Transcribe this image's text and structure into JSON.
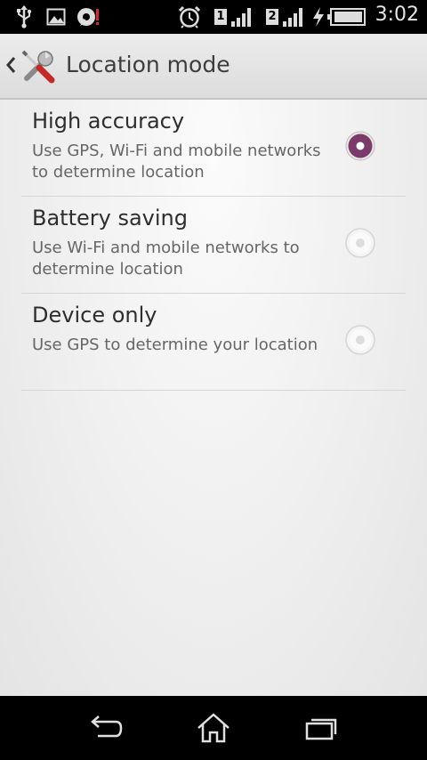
{
  "status_bar": {
    "time": "3:02",
    "sim1_label": "1",
    "sim2_label": "2",
    "icons": [
      "usb-icon",
      "image-icon",
      "notification-icon",
      "alarm-icon",
      "signal-icon",
      "charging-icon",
      "battery-icon"
    ]
  },
  "action_bar": {
    "title": "Location mode",
    "icon": "settings-tools-icon"
  },
  "options": [
    {
      "title": "High accuracy",
      "description": "Use GPS, Wi-Fi and mobile networks to determine location",
      "selected": true
    },
    {
      "title": "Battery saving",
      "description": "Use Wi-Fi and mobile networks to determine location",
      "selected": false
    },
    {
      "title": "Device only",
      "description": "Use GPS to determine your location",
      "selected": false
    }
  ],
  "colors": {
    "radio_selected": "#7b3a69",
    "radio_unselected": "#d0d0d0"
  },
  "nav_bar": {
    "icons": [
      "back-icon",
      "home-icon",
      "recent-apps-icon"
    ]
  }
}
